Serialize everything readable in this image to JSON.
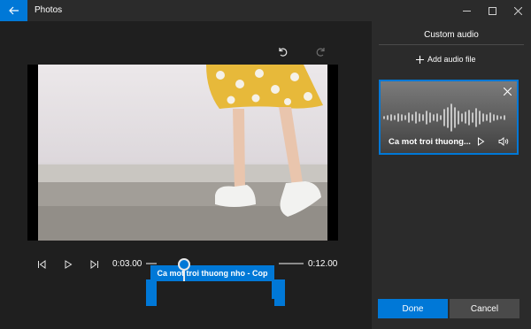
{
  "app": {
    "title": "Photos"
  },
  "controls": {
    "time_start": "0:03.00",
    "time_end": "0:12.00"
  },
  "clip": {
    "label": "Ca mot troi thuong nho - Cop"
  },
  "panel": {
    "title": "Custom audio",
    "add_audio_label": "Add audio file",
    "audio_items": [
      {
        "name": "Ca mot troi thuong..."
      }
    ],
    "done_label": "Done",
    "cancel_label": "Cancel"
  },
  "colors": {
    "accent": "#0078d7",
    "panel_bg": "#2b2b2b",
    "editor_bg": "#1f1f1f",
    "button_secondary": "#4a4a4a"
  },
  "icons": [
    "back-arrow-icon",
    "minimize-icon",
    "maximize-icon",
    "close-icon",
    "undo-icon",
    "redo-icon",
    "skip-back-icon",
    "play-icon",
    "skip-forward-icon",
    "plus-icon",
    "volume-icon",
    "remove-icon"
  ]
}
